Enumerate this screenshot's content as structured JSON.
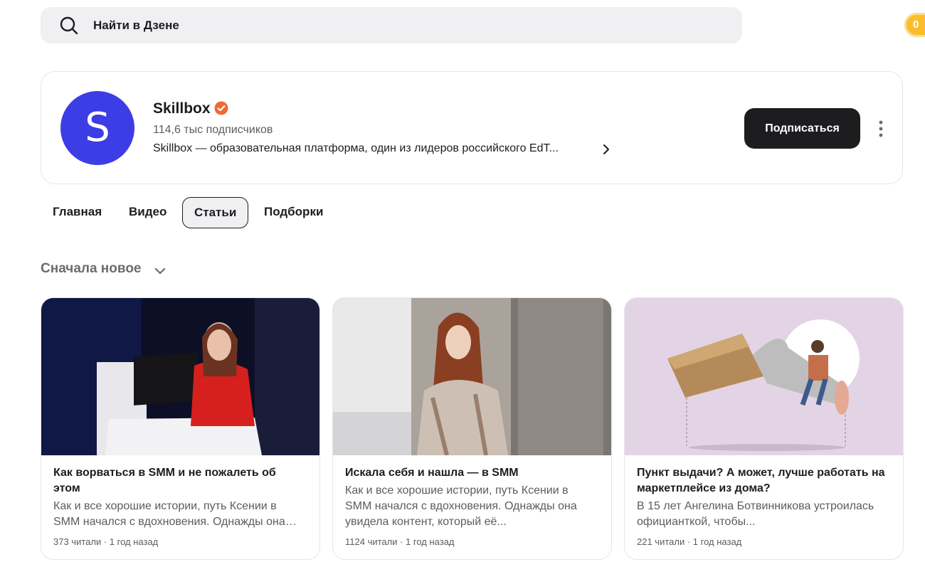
{
  "search": {
    "placeholder": "Найти в Дзене"
  },
  "coin": {
    "label": "0"
  },
  "channel": {
    "avatar_letter": "S",
    "name": "Skillbox",
    "subscribers": "114,6 тыс подписчиков",
    "description": "Skillbox — образовательная платформа, один из лидеров российского EdT...",
    "subscribe_label": "Подписаться",
    "accent": "#3d3de6",
    "verified_color": "#f06a33"
  },
  "tabs": [
    {
      "label": "Главная",
      "active": false
    },
    {
      "label": "Видео",
      "active": false
    },
    {
      "label": "Статьи",
      "active": true
    },
    {
      "label": "Подборки",
      "active": false
    }
  ],
  "sort": {
    "label": "Сначала новое"
  },
  "articles": [
    {
      "title": "Как ворваться в SMM и не пожалеть об этом",
      "snippet": "Как и все хорошие истории, путь Ксении в SMM начался с вдохновения. Однажды она увидела контент, который её...",
      "meta": "373 читали · 1 год назад"
    },
    {
      "title": "Искала себя и нашла — в SMM",
      "snippet": "Как и все хорошие истории, путь Ксении в SMM начался с вдохновения. Однажды она увидела контент, который её...",
      "meta": "1124 читали · 1 год назад"
    },
    {
      "title": "Пункт выдачи? А может, лучше работать на маркетплейсе из дома?",
      "snippet": "В 15 лет Ангелина Ботвинникова устроилась официанткой, чтобы...",
      "meta": "221 читали · 1 год назад"
    }
  ]
}
